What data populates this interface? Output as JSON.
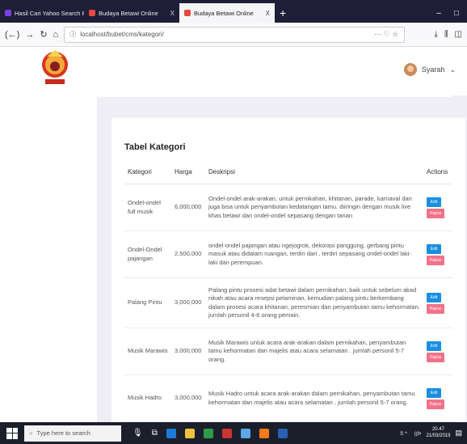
{
  "browser": {
    "tabs": [
      {
        "label": "Hasil Cari Yahoo Search Result",
        "color": "#7b3fe4",
        "close": "X"
      },
      {
        "label": "Budaya Betawi Online",
        "color": "#e8483f",
        "close": "X"
      },
      {
        "label": "Budaya Betawi Online",
        "color": "#e8483f",
        "close": "X"
      }
    ],
    "new_tab": "+",
    "window_controls": [
      "–",
      "□"
    ],
    "url": "localhost/bubet/cms/kategori/",
    "url_actions": "··· ♡ ☆"
  },
  "user": {
    "name": "Syarah",
    "caret": "⌄"
  },
  "table": {
    "title": "Tabel Kategori",
    "headers": [
      "Kategori",
      "Harga",
      "Deskripsi",
      "Actions"
    ],
    "edit_label": "Edit",
    "hapus_label": "Hapus",
    "rows": [
      {
        "kategori": "Ondel-ondel full musik",
        "harga": "6,000,000",
        "deskripsi": "Ondel-ondel arak-arakan, untuk pernikahan, khitanan, parade, karnaval dan juga bisa untuk penyambutan kedatangan tamu. diiringin dengan musik live khas betawi dan ondel-ondel sepasang dengan tarian"
      },
      {
        "kategori": "Ondel-Ondel pajangan",
        "harga": "2,500,000",
        "deskripsi": "ondel-ondel pajangan atau ngejogrok, dekorasi panggung, gerbang pintu masuk atau didalam ruangan, terdiri dari , terdiri sepasang ondel-ondel laki-laki dan perempuan."
      },
      {
        "kategori": "Palang Pintu",
        "harga": "3,000,000",
        "deskripsi": "Palang pintu prosesi adat betawi dalam pernikahan, baik untuk sebelum akad nikah atau acara resepsi pelaminan, kemudian palang pintu berkembang dalam prosesi acara khitanan, peresmian dan penyambutan tamu kehormatan. jumlah personil 4-6 orang pemain."
      },
      {
        "kategori": "Musik Marawis",
        "harga": "3,000,000",
        "deskripsi": "Musik Marawis untuk acara arak-arakan dalam pernikahan, penyambutan tamu kehormatan dan majelis atau acara selamatan . jumlah personil 5-7 orang."
      },
      {
        "kategori": "Musik Hadro",
        "harga": "3,000,000",
        "deskripsi": "Musik Hadro untuk acara arak-arakan dalam pernikahan, penyambutan tamu kehormatan dan majelis atau acara selamatan . jumlah personil 5-7 orang."
      }
    ]
  },
  "taskbar": {
    "search_placeholder": "Type here to search",
    "time": "20.47",
    "date": "21/03/2019",
    "tray_text": "ℛ ^ ㅤ ((ᐅ"
  }
}
